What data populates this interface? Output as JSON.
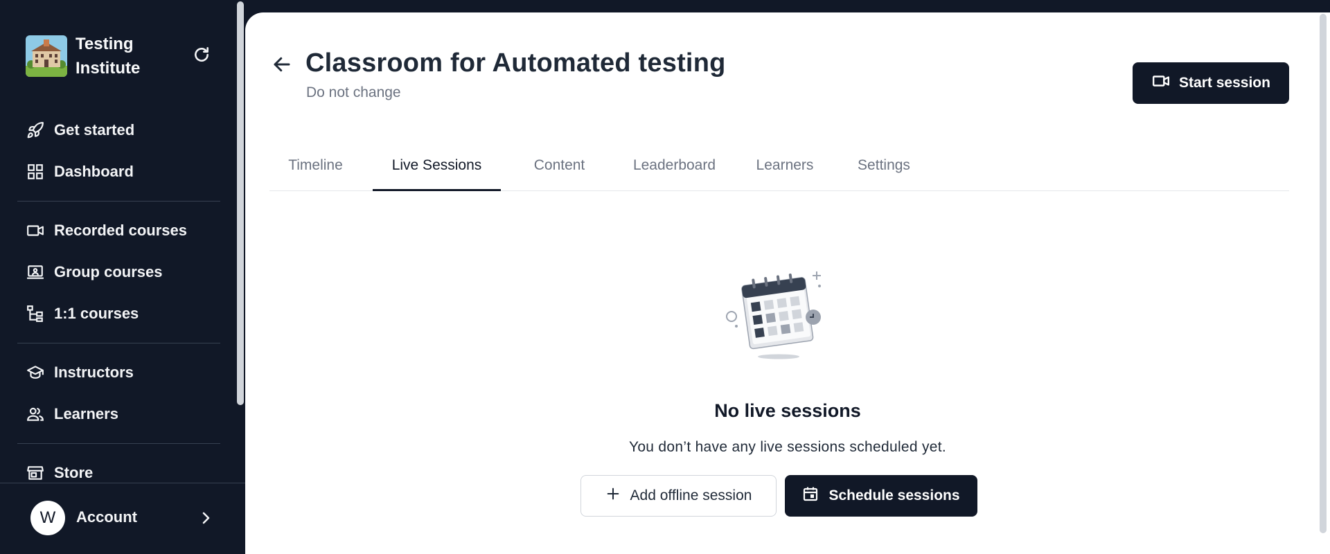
{
  "brand": {
    "name": "Testing Institute",
    "logo_icon": "institute-building-logo"
  },
  "sidebar": {
    "items": [
      {
        "label": "Get started",
        "icon": "rocket-icon"
      },
      {
        "label": "Dashboard",
        "icon": "grid-icon"
      },
      {
        "label": "Recorded courses",
        "icon": "video-icon"
      },
      {
        "label": "Group courses",
        "icon": "presentation-icon"
      },
      {
        "label": "1:1 courses",
        "icon": "hierarchy-icon"
      },
      {
        "label": "Instructors",
        "icon": "graduation-cap-icon"
      },
      {
        "label": "Learners",
        "icon": "users-icon"
      },
      {
        "label": "Store",
        "icon": "store-icon"
      }
    ],
    "account": {
      "label": "Account",
      "avatar_initial": "W"
    }
  },
  "header": {
    "title": "Classroom for Automated testing",
    "subtitle": "Do not change",
    "start_button": "Start session"
  },
  "tabs": [
    {
      "label": "Timeline",
      "active": false
    },
    {
      "label": "Live Sessions",
      "active": true
    },
    {
      "label": "Content",
      "active": false
    },
    {
      "label": "Leaderboard",
      "active": false
    },
    {
      "label": "Learners",
      "active": false
    },
    {
      "label": "Settings",
      "active": false
    }
  ],
  "empty_state": {
    "title": "No live sessions",
    "description": "You don’t have any live sessions scheduled yet.",
    "add_offline_label": "Add offline session",
    "schedule_label": "Schedule sessions"
  },
  "colors": {
    "sidebar_bg": "#111827",
    "accent_dark": "#111827",
    "muted_text": "#6b7280"
  }
}
